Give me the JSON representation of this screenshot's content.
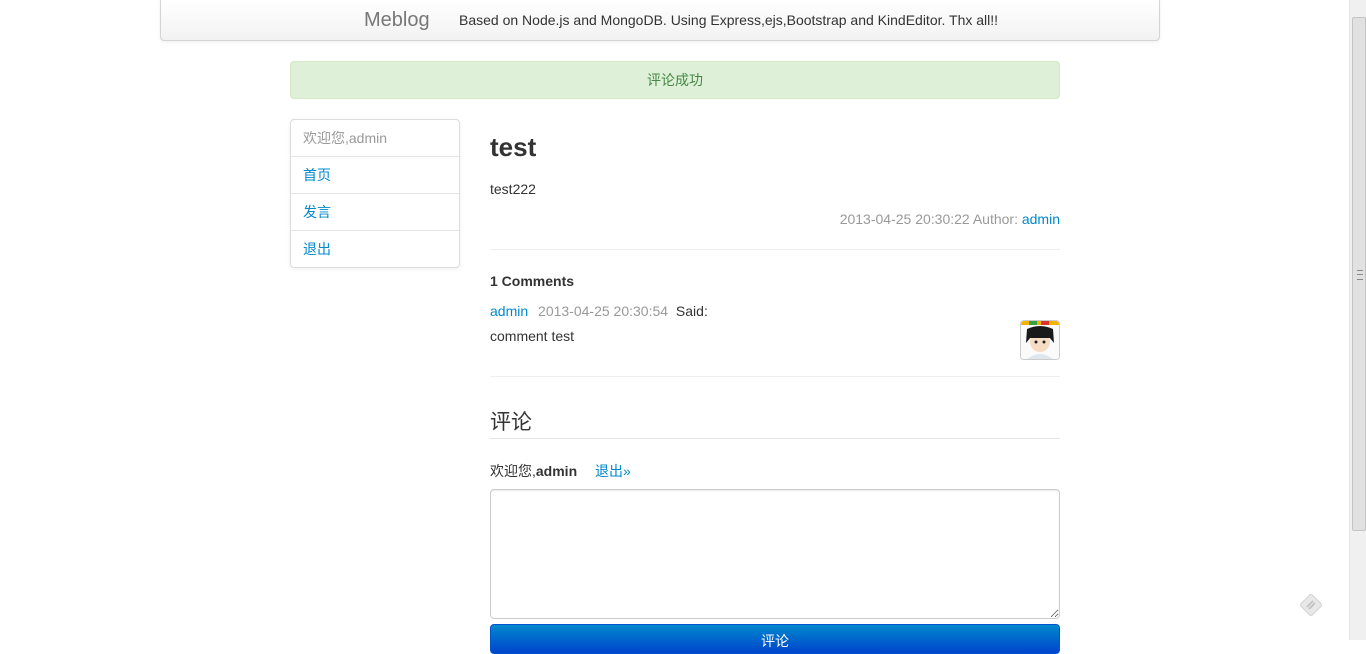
{
  "navbar": {
    "brand": "Meblog",
    "text": "Based on Node.js and MongoDB. Using Express,ejs,Bootstrap and KindEditor. Thx all!!"
  },
  "alert": {
    "message": "评论成功"
  },
  "sidebar": {
    "items": [
      {
        "label": "欢迎您,admin"
      },
      {
        "label": "首页"
      },
      {
        "label": "发言"
      },
      {
        "label": "退出"
      }
    ]
  },
  "post": {
    "title": "test",
    "body": "test222",
    "date": "2013-04-25 20:30:22",
    "author_label": "Author:",
    "author": "admin"
  },
  "comments": {
    "count_label": "1 Comments",
    "items": [
      {
        "author": "admin",
        "time": "2013-04-25 20:30:54",
        "said": "Said:",
        "text": "comment test"
      }
    ]
  },
  "comment_form": {
    "title": "评论",
    "welcome_prefix": "欢迎您,",
    "user": "admin",
    "logout": "退出»",
    "textarea_value": "",
    "submit_label": "评论"
  },
  "colors": {
    "link": "#0088cc",
    "alert_bg": "#dff0d8",
    "alert_text": "#468847",
    "button": "#0066cc"
  },
  "icons": [
    "avatar-image",
    "feedback-icon",
    "scrollbar-grip-icon"
  ]
}
